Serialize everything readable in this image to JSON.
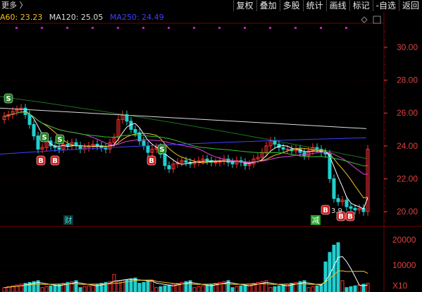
{
  "menu": {
    "title": "更多 〉"
  },
  "toolbar": [
    {
      "label": "复权",
      "name": "fuquan-button"
    },
    {
      "label": "叠加",
      "name": "diejia-button"
    },
    {
      "label": "多股",
      "name": "duogu-button"
    },
    {
      "label": "统计",
      "name": "tongji-button"
    },
    {
      "label": "画线",
      "name": "huaxian-button"
    },
    {
      "label": "标记",
      "name": "biaoji-button"
    },
    {
      "label": "-自选",
      "name": "zixuan-button"
    },
    {
      "label": "返回",
      "name": "fanhui-button"
    }
  ],
  "ma_legend": {
    "ma60": "A60: 23.23",
    "ma120": "MA120: 25.05",
    "ma250": "MA250: 24.49",
    "colors": {
      "ma60": "#f0c020",
      "ma120": "#dcdcdc",
      "ma250": "#4040ff"
    }
  },
  "price_axis": [
    "30.00",
    "28.00",
    "26.00",
    "24.00",
    "22.00",
    "20.00"
  ],
  "price_marker": "3.9",
  "volume_axis": [
    "20000",
    "10000",
    "X10"
  ],
  "events": {
    "finance_label": "财",
    "reduce_label": "减"
  },
  "signals": [
    {
      "type": "S",
      "label": "S"
    },
    {
      "type": "S",
      "label": "S"
    },
    {
      "type": "S",
      "label": "S"
    },
    {
      "type": "S",
      "label": "S"
    },
    {
      "type": "B",
      "label": "B"
    },
    {
      "type": "B",
      "label": "B"
    },
    {
      "type": "B",
      "label": "B"
    },
    {
      "type": "B",
      "label": "B"
    },
    {
      "type": "B",
      "label": "B"
    },
    {
      "type": "B",
      "label": "B"
    }
  ],
  "colors": {
    "up": "#ff3030",
    "down": "#20d0d0",
    "axis_text": "#e04040",
    "grid": "#5a0000"
  },
  "icons": {
    "diamond": "diamond-icon",
    "expand": "expand-icon"
  }
}
